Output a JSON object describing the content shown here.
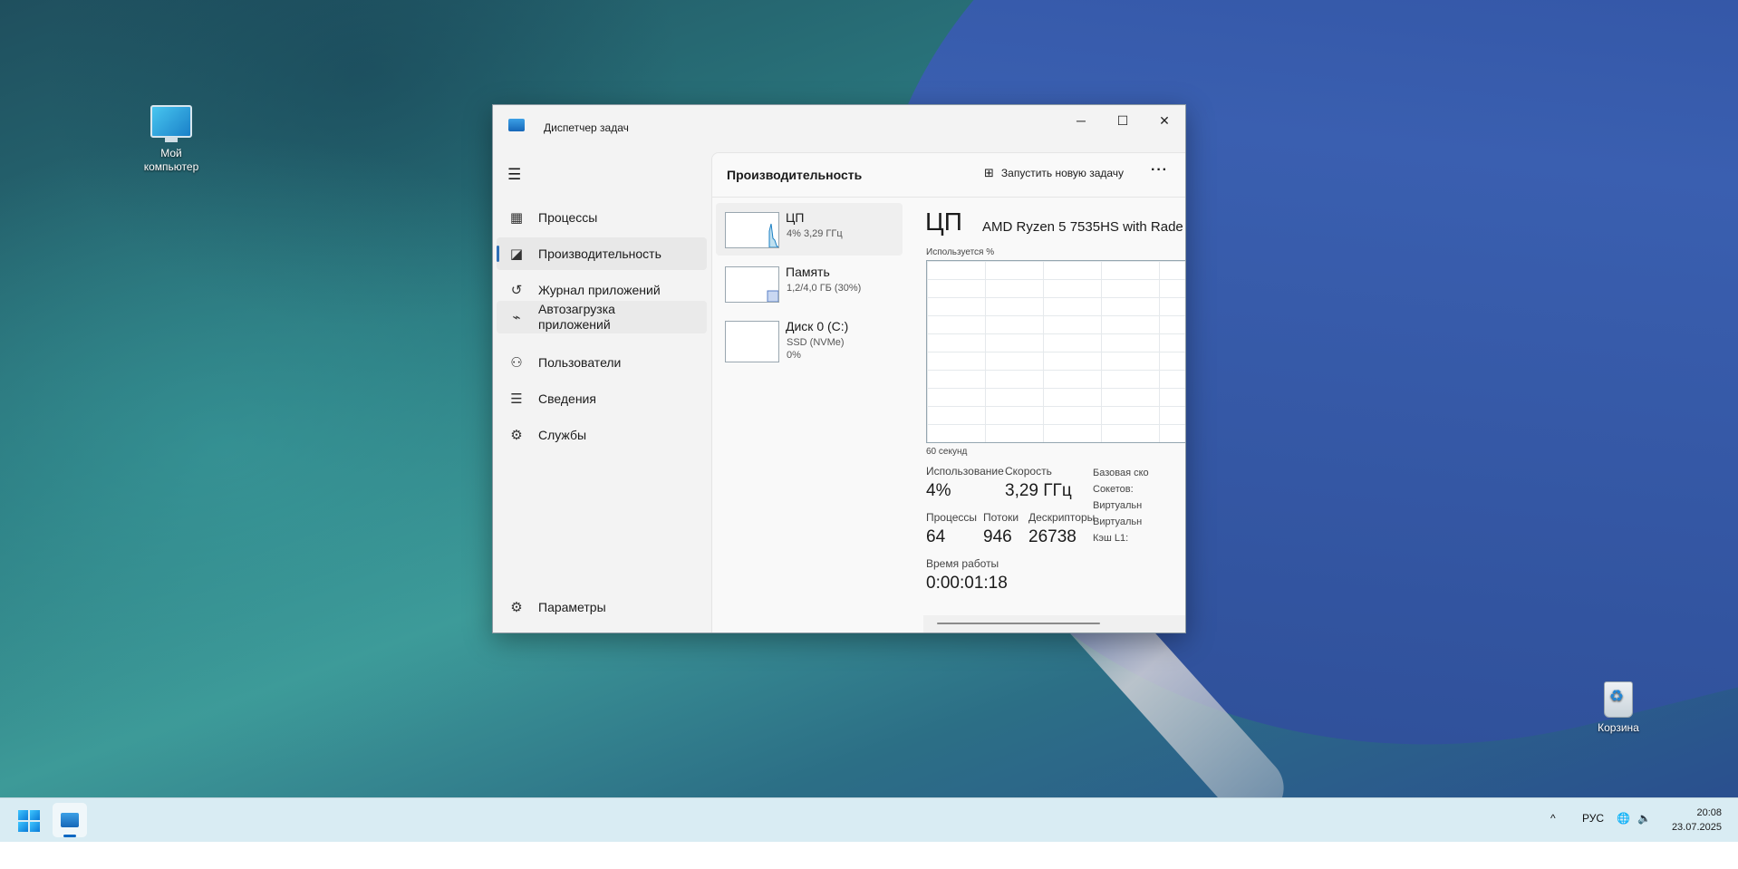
{
  "desktop": {
    "icons": [
      {
        "label": "Мой\nкомпьютер"
      },
      {
        "label": "Корзина"
      }
    ]
  },
  "window": {
    "title": "Диспетчер задач",
    "controls": {
      "minimize": "─",
      "maximize": "☐",
      "close": "✕"
    }
  },
  "sidebar": {
    "items": [
      {
        "label": "Процессы",
        "icon": "processes-icon"
      },
      {
        "label": "Производительность",
        "icon": "performance-icon",
        "selected": true
      },
      {
        "label": "Журнал приложений",
        "icon": "history-icon"
      },
      {
        "label": "Автозагрузка\nприложений",
        "icon": "startup-icon"
      },
      {
        "label": "Пользователи",
        "icon": "users-icon"
      },
      {
        "label": "Сведения",
        "icon": "details-icon"
      },
      {
        "label": "Службы",
        "icon": "services-icon"
      }
    ],
    "settings_label": "Параметры"
  },
  "header": {
    "title": "Производительность",
    "run_task_label": "Запустить новую задачу",
    "more": "···"
  },
  "resources": [
    {
      "name": "ЦП",
      "sub": "4%  3,29 ГГц"
    },
    {
      "name": "Память",
      "sub": "1,2/4,0 ГБ (30%)"
    },
    {
      "name": "Диск 0 (C:)",
      "sub": "SSD (NVMe)",
      "sub2": "0%"
    }
  ],
  "detail": {
    "title": "ЦП",
    "model": "AMD Ryzen 5 7535HS with Rade",
    "usage_label": "Используется %",
    "time_label": "60 секунд",
    "stats": {
      "usage_k": "Использование",
      "usage_v": "4%",
      "speed_k": "Скорость",
      "speed_v": "3,29 ГГц",
      "proc_k": "Процессы",
      "proc_v": "64",
      "threads_k": "Потоки",
      "threads_v": "946",
      "handles_k": "Дескрипторы",
      "handles_v": "26738",
      "uptime_k": "Время работы",
      "uptime_v": "0:00:01:18"
    },
    "side_info": [
      "Базовая ско",
      "Сокетов:",
      "Виртуальн",
      "Виртуальн",
      "Кэш L1:"
    ]
  },
  "taskbar": {
    "lang": "РУС",
    "time": "20:08",
    "date": "23.07.2025",
    "chevron": "^"
  },
  "colors": {
    "accent": "#2f6fb6",
    "taskbar": "#d9ecf3"
  }
}
